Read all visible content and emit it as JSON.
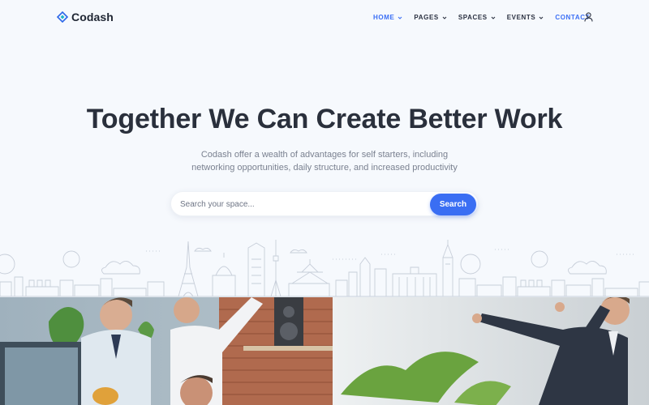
{
  "brand": {
    "name": "Codash"
  },
  "nav": {
    "items": [
      {
        "label": "HOME",
        "active": true,
        "dropdown": true
      },
      {
        "label": "PAGES",
        "active": false,
        "dropdown": true
      },
      {
        "label": "SPACES",
        "active": false,
        "dropdown": true
      },
      {
        "label": "EVENTS",
        "active": false,
        "dropdown": true
      },
      {
        "label": "CONTACT",
        "active": false,
        "dropdown": false
      }
    ],
    "account_icon": "user-icon"
  },
  "hero": {
    "title": "Together We Can Create Better Work",
    "subtitle_line1": "Codash offer a wealth of advantages for self starters, including",
    "subtitle_line2": "networking opportunities, daily structure, and increased productivity"
  },
  "search": {
    "placeholder": "Search your space...",
    "value": "",
    "button_label": "Search"
  },
  "colors": {
    "accent": "#3b6ff5",
    "background": "#f6f9fd",
    "heading": "#2a303c",
    "muted": "#7a8190"
  }
}
